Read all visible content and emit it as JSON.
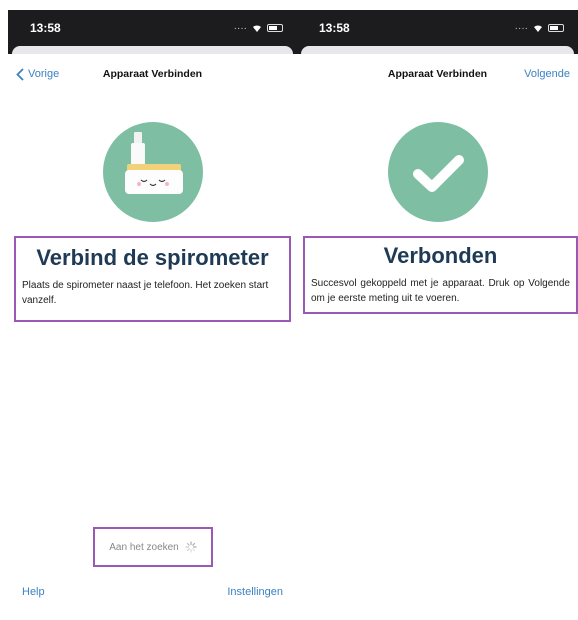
{
  "left_screen": {
    "status": {
      "time": "13:58"
    },
    "nav": {
      "back_label": "Vorige",
      "title": "Apparaat Verbinden"
    },
    "hero_icon": "spirometer-device-icon",
    "headline": "Verbind de spirometer",
    "body": "Plaats de spirometer naast je telefoon. Het zoeken start vanzelf.",
    "searching_label": "Aan het zoeken",
    "footer": {
      "help_label": "Help",
      "settings_label": "Instellingen"
    }
  },
  "right_screen": {
    "status": {
      "time": "13:58"
    },
    "nav": {
      "title": "Apparaat Verbinden",
      "next_label": "Volgende"
    },
    "hero_icon": "checkmark-icon",
    "headline": "Verbonden",
    "body": "Succesvol gekoppeld met je apparaat. Druk op Volgende om je eerste meting uit te voeren."
  },
  "colors": {
    "accent": "#3b82c4",
    "hero_circle": "#7ebfa3",
    "headline": "#1e3a55",
    "highlight_border": "#9b59b6"
  }
}
